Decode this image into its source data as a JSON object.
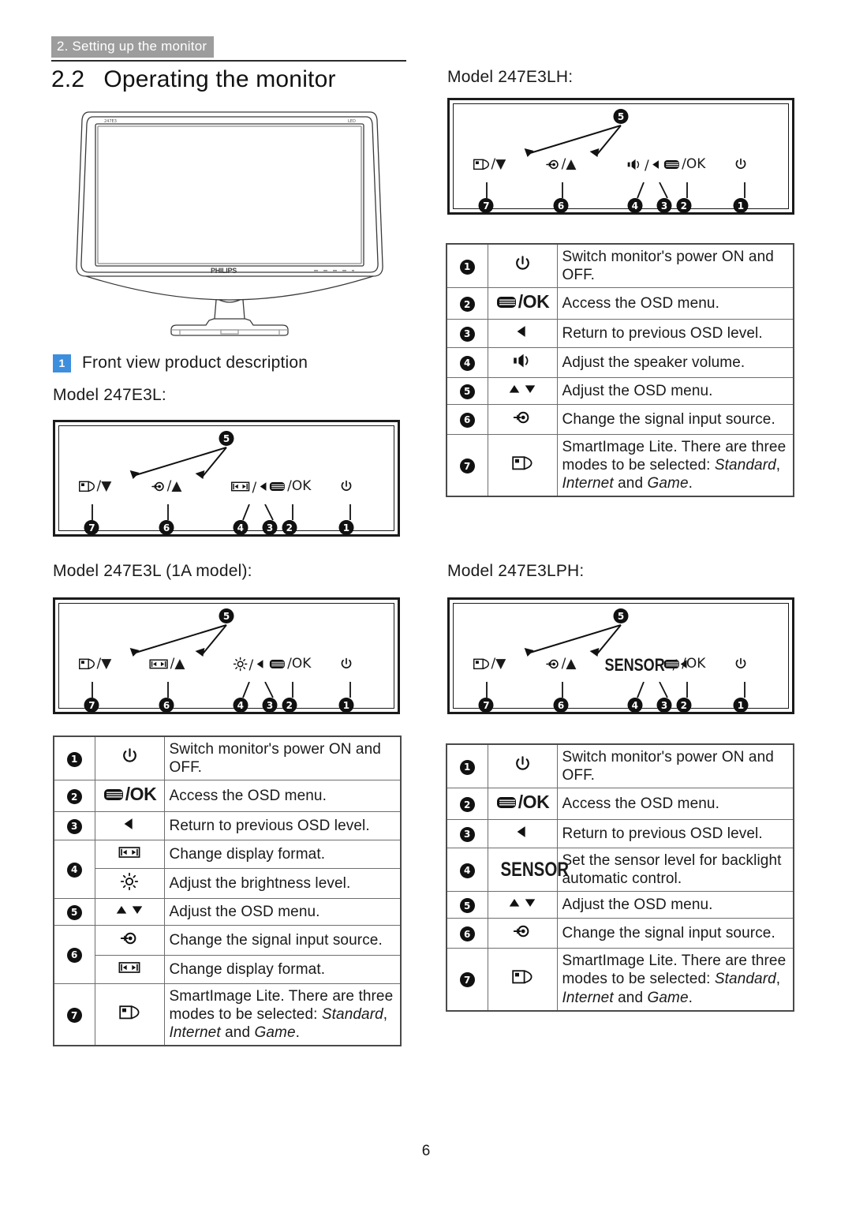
{
  "header": {
    "running_head": "2. Setting up the monitor",
    "section_number": "2.2",
    "section_title": "Operating the monitor"
  },
  "monitor_image": {
    "screen_label_left": "247E3",
    "screen_label_right": "LED",
    "brand": "PHILIPS"
  },
  "front_view": {
    "badge": "1",
    "title": "Front view product description"
  },
  "models": {
    "e3l": "Model 247E3L:",
    "e3l_1a": "Model 247E3L (1A model):",
    "e3lh": "Model 247E3LH:",
    "e3lph": "Model 247E3LPH:"
  },
  "panels": {
    "e3l": {
      "top_number": "5",
      "keys": [
        {
          "number": "7",
          "glyph": "smartimage",
          "suffix": "/▼"
        },
        {
          "number": "6",
          "glyph": "input",
          "suffix": "/▲"
        },
        {
          "number": "4",
          "glyph": "format",
          "suffix": ""
        },
        {
          "number": "3",
          "glyph": "left",
          "suffix": ""
        },
        {
          "number": "2",
          "glyph": "osd",
          "suffix": "/OK"
        },
        {
          "number": "1",
          "glyph": "power",
          "suffix": ""
        }
      ]
    },
    "e3l_1a": {
      "top_number": "5",
      "keys": [
        {
          "number": "7",
          "glyph": "smartimage",
          "suffix": "/▼"
        },
        {
          "number": "6",
          "glyph": "format",
          "suffix": "/▲"
        },
        {
          "number": "4",
          "glyph": "brightness",
          "suffix": ""
        },
        {
          "number": "3",
          "glyph": "left",
          "suffix": ""
        },
        {
          "number": "2",
          "glyph": "osd",
          "suffix": "/OK"
        },
        {
          "number": "1",
          "glyph": "power",
          "suffix": ""
        }
      ]
    },
    "e3lh": {
      "top_number": "5",
      "keys": [
        {
          "number": "7",
          "glyph": "smartimage",
          "suffix": "/▼"
        },
        {
          "number": "6",
          "glyph": "input",
          "suffix": "/▲"
        },
        {
          "number": "4",
          "glyph": "volume",
          "suffix": ""
        },
        {
          "number": "3",
          "glyph": "left",
          "suffix": ""
        },
        {
          "number": "2",
          "glyph": "osd",
          "suffix": "/OK"
        },
        {
          "number": "1",
          "glyph": "power",
          "suffix": ""
        }
      ]
    },
    "e3lph": {
      "top_number": "5",
      "keys": [
        {
          "number": "7",
          "glyph": "smartimage",
          "suffix": "/▼"
        },
        {
          "number": "6",
          "glyph": "input",
          "suffix": "/▲"
        },
        {
          "number": "4",
          "glyph": "sensor",
          "suffix": ""
        },
        {
          "number": "3",
          "glyph": "left",
          "suffix": ""
        },
        {
          "number": "2",
          "glyph": "osd",
          "suffix": "/OK"
        },
        {
          "number": "1",
          "glyph": "power",
          "suffix": ""
        }
      ]
    }
  },
  "tables": {
    "e3l": [
      {
        "number": "1",
        "icon": "power",
        "text": "Switch monitor's power ON and OFF."
      },
      {
        "number": "2",
        "icon": "osd-ok",
        "text": "Access the OSD menu."
      },
      {
        "number": "3",
        "icon": "left",
        "text": "Return to previous OSD level."
      },
      {
        "number": "4",
        "icon": "format",
        "text": "Change display format."
      },
      {
        "number": "4b",
        "icon": "brightness",
        "text": "Adjust the brightness level."
      },
      {
        "number": "5",
        "icon": "updown",
        "text": "Adjust the OSD menu."
      },
      {
        "number": "6",
        "icon": "input",
        "text": "Change the signal input source."
      },
      {
        "number": "6b",
        "icon": "format",
        "text": "Change display format."
      },
      {
        "number": "7",
        "icon": "smartimage",
        "text_pre": "SmartImage Lite. There are three modes to be selected: ",
        "text_em1": "Standard",
        "text_mid": ", ",
        "text_em2": "Internet",
        "text_mid2": " and ",
        "text_em3": "Game",
        "text_end": "."
      }
    ],
    "e3lh": [
      {
        "number": "1",
        "icon": "power",
        "text": "Switch monitor's power ON and OFF."
      },
      {
        "number": "2",
        "icon": "osd-ok",
        "text": "Access the OSD menu."
      },
      {
        "number": "3",
        "icon": "left",
        "text": "Return to previous OSD level."
      },
      {
        "number": "4",
        "icon": "volume",
        "text": "Adjust the speaker volume."
      },
      {
        "number": "5",
        "icon": "updown",
        "text": "Adjust the OSD menu."
      },
      {
        "number": "6",
        "icon": "input",
        "text": "Change the signal input source."
      },
      {
        "number": "7",
        "icon": "smartimage",
        "text_pre": "SmartImage Lite. There are three modes to be selected: ",
        "text_em1": "Standard",
        "text_mid": ", ",
        "text_em2": "Internet",
        "text_mid2": " and ",
        "text_em3": "Game",
        "text_end": "."
      }
    ],
    "e3lph": [
      {
        "number": "1",
        "icon": "power",
        "text": "Switch monitor's power ON and OFF."
      },
      {
        "number": "2",
        "icon": "osd-ok",
        "text": "Access the OSD menu."
      },
      {
        "number": "3",
        "icon": "left",
        "text": "Return to previous OSD level."
      },
      {
        "number": "4",
        "icon": "sensor",
        "text": "Set the sensor level for backlight automatic control."
      },
      {
        "number": "5",
        "icon": "updown",
        "text": "Adjust the OSD menu."
      },
      {
        "number": "6",
        "icon": "input",
        "text": "Change the signal input source."
      },
      {
        "number": "7",
        "icon": "smartimage",
        "text_pre": "SmartImage Lite. There are three modes to be selected: ",
        "text_em1": "Standard",
        "text_mid": ", ",
        "text_em2": "Internet",
        "text_mid2": " and ",
        "text_em3": "Game",
        "text_end": "."
      }
    ]
  },
  "labels": {
    "ok_suffix": "/OK",
    "sensor_word": "SENSOR",
    "updown": "▲ ▼",
    "left_arrow": "◀"
  },
  "footer": {
    "page_number": "6"
  },
  "colors": {
    "running_head_bg": "#9d9d9d",
    "badge_blue": "#3d8fdd",
    "ink": "#1a1a1a",
    "rule": "#2b2b2b"
  }
}
